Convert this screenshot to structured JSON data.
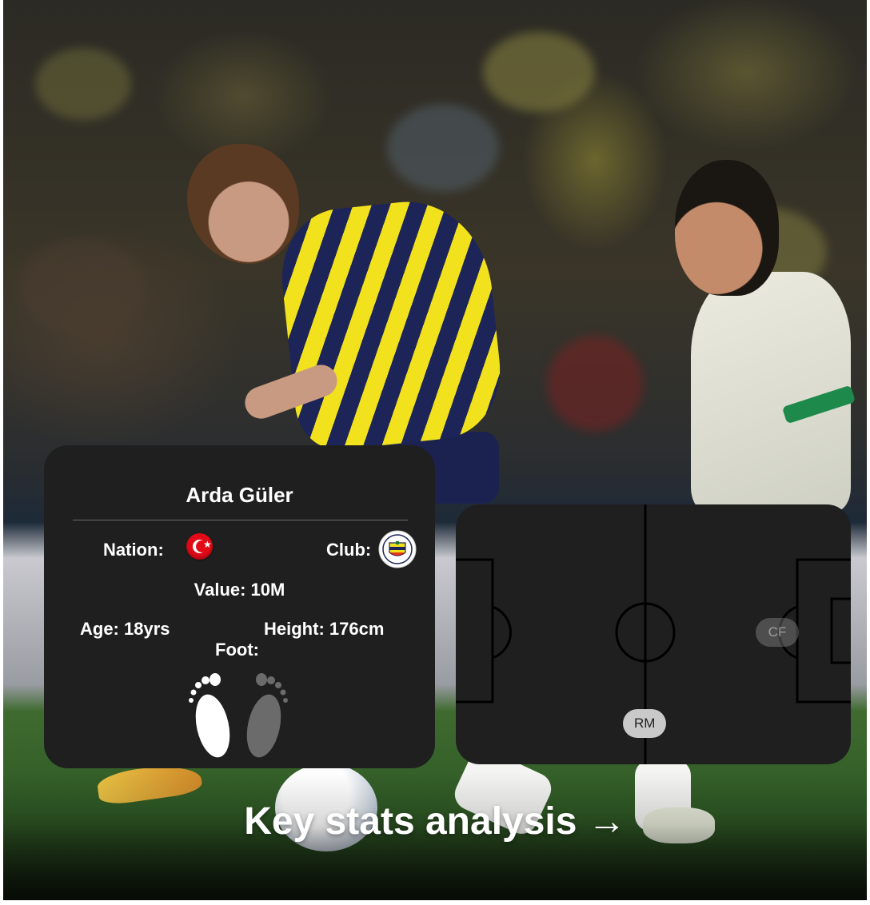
{
  "player": {
    "name": "Arda Güler",
    "nation_label": "Nation:",
    "nation_flag": "turkey-flag-icon",
    "club_label": "Club:",
    "club_logo": "fenerbahce-logo-icon",
    "value_label": "Value: 10M",
    "age_label": "Age: 18yrs",
    "height_label": "Height: 176cm",
    "foot_label": "Foot:",
    "preferred_foot": "left"
  },
  "pitch": {
    "positions": [
      {
        "code": "RM",
        "primary": true
      },
      {
        "code": "CF",
        "primary": false
      }
    ]
  },
  "cta": {
    "label": "Key stats analysis →"
  },
  "colors": {
    "card_bg": "#1f1f1f",
    "primary_badge": "#c9c9c9",
    "secondary_badge": "rgba(200,200,200,0.28)",
    "text": "#ffffff"
  }
}
